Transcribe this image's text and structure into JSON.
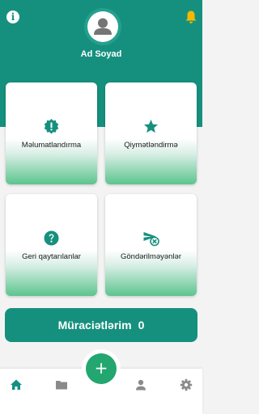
{
  "header": {
    "user_name": "Ad Soyad",
    "info_icon": "info-icon",
    "notification_icon": "bell-icon",
    "bell_color": "#f5b800",
    "background_color": "#16907e"
  },
  "cards": [
    {
      "label": "Məlumatlandırma",
      "icon": "alert-badge-icon"
    },
    {
      "label": "Qiymətləndirmə",
      "icon": "star-icon"
    },
    {
      "label": "Geri qaytarılanlar",
      "icon": "help-icon"
    },
    {
      "label": "Göndərilməyənlər",
      "icon": "not-sent-icon"
    }
  ],
  "applications": {
    "label": "Müraciətlərim",
    "count": "0"
  },
  "fab": {
    "label": "+",
    "icon": "plus-icon",
    "color": "#23a66f"
  },
  "bottom_nav": [
    {
      "name": "home",
      "icon": "home-icon",
      "active": true,
      "color": "#16907e"
    },
    {
      "name": "folder",
      "icon": "folder-icon",
      "active": false,
      "color": "#8a8a8a"
    },
    {
      "name": "profile",
      "icon": "person-icon",
      "active": false,
      "color": "#8a8a8a"
    },
    {
      "name": "settings",
      "icon": "gear-icon",
      "active": false,
      "color": "#8a8a8a"
    }
  ]
}
